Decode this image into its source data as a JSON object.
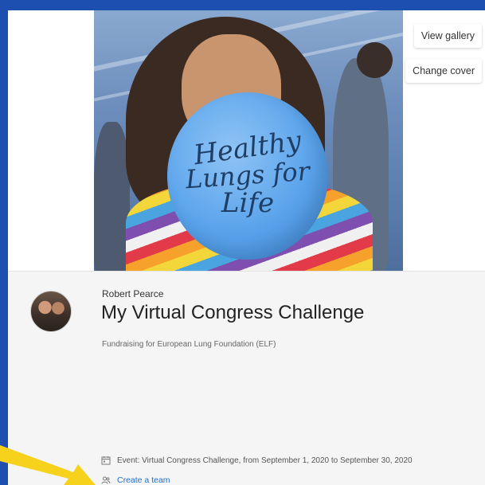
{
  "cover": {
    "balloon_lines": [
      "Healthy",
      "Lungs for",
      "Life"
    ],
    "view_gallery_label": "View gallery",
    "change_cover_label": "Change cover"
  },
  "profile": {
    "owner_name": "Robert Pearce",
    "page_title": "My Virtual Congress Challenge",
    "subtitle": "Fundraising for European Lung Foundation (ELF)"
  },
  "details": {
    "event_text": "Event: Virtual Congress Challenge, from September 1, 2020 to September 30, 2020",
    "event_icon": "calendar-icon",
    "team_link": "Create a team",
    "team_icon": "team-icon"
  },
  "colors": {
    "page_background": "#1d4fb0",
    "link": "#1e6fd0",
    "annotation_arrow": "#f6d21c"
  }
}
